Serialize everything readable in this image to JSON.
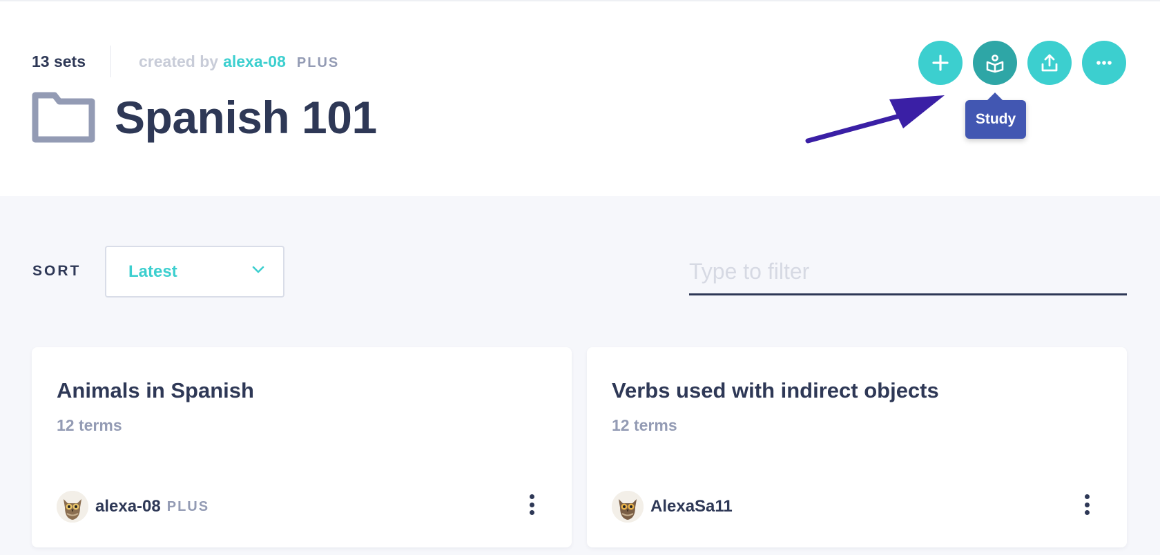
{
  "header": {
    "sets_count": "13 sets",
    "created_by_label": "created by",
    "creator": "alexa-08",
    "creator_badge": "PLUS",
    "folder_title": "Spanish 101",
    "actions": [
      {
        "name": "add",
        "icon": "plus-icon"
      },
      {
        "name": "study",
        "icon": "study-book-icon"
      },
      {
        "name": "share",
        "icon": "upload-icon"
      },
      {
        "name": "more",
        "icon": "more-horizontal-icon"
      }
    ],
    "tooltip": "Study"
  },
  "controls": {
    "sort_label": "SORT",
    "sort_value": "Latest",
    "filter_placeholder": "Type to filter",
    "filter_value": ""
  },
  "cards": [
    {
      "title": "Animals in Spanish",
      "terms": "12 terms",
      "author": "alexa-08",
      "author_badge": "PLUS"
    },
    {
      "title": "Verbs used with indirect objects",
      "terms": "12 terms",
      "author": "AlexaSa11",
      "author_badge": ""
    }
  ],
  "colors": {
    "accent": "#3ccfcf",
    "accent_active": "#2ea6a6",
    "tooltip_bg": "#4257b2",
    "text_primary": "#2e3856",
    "text_muted": "#939bb4",
    "annotation_arrow": "#3a1fa5"
  }
}
